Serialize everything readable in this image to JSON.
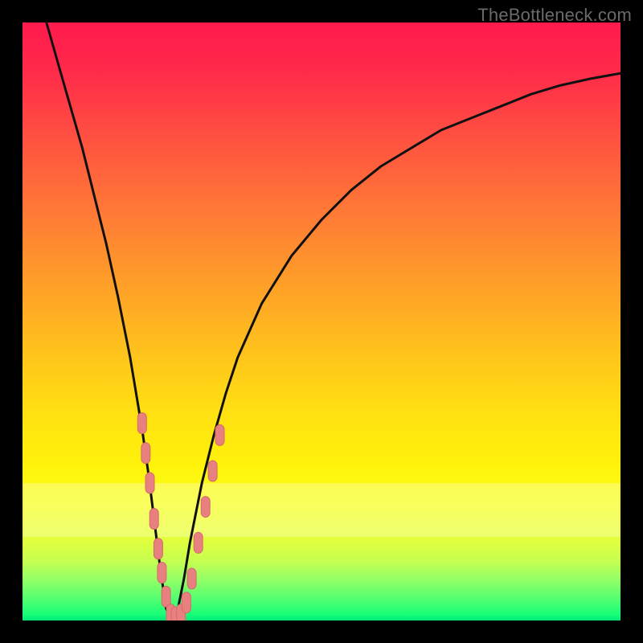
{
  "watermark": "TheBottleneck.com",
  "colors": {
    "frame": "#000000",
    "curve": "#111111",
    "marker_fill": "#e98080",
    "marker_stroke": "#d36b6b"
  },
  "chart_data": {
    "type": "line",
    "title": "",
    "xlabel": "",
    "ylabel": "",
    "xlim": [
      0,
      100
    ],
    "ylim": [
      0,
      100
    ],
    "grid": false,
    "legend": false,
    "series": [
      {
        "name": "bottleneck-curve",
        "x": [
          4,
          6,
          8,
          10,
          12,
          14,
          16,
          18,
          20,
          21,
          22,
          23,
          24,
          25,
          26,
          27,
          28,
          30,
          32,
          34,
          36,
          40,
          45,
          50,
          55,
          60,
          65,
          70,
          75,
          80,
          85,
          90,
          95,
          100
        ],
        "y": [
          100,
          93,
          86,
          79,
          71,
          63,
          54,
          44,
          32,
          25,
          17,
          9,
          2,
          0,
          2,
          7,
          13,
          23,
          31,
          38,
          44,
          53,
          61,
          67,
          72,
          76,
          79,
          82,
          84,
          86,
          88,
          89.5,
          90.6,
          91.5
        ]
      }
    ],
    "annotations": {
      "pale_band_y_range": [
        16,
        25
      ]
    },
    "markers": {
      "name": "datapoints-overlay",
      "shape": "capsule",
      "points": [
        {
          "x": 20.0,
          "y": 33
        },
        {
          "x": 20.6,
          "y": 28
        },
        {
          "x": 21.3,
          "y": 23
        },
        {
          "x": 22.0,
          "y": 17
        },
        {
          "x": 22.7,
          "y": 12
        },
        {
          "x": 23.3,
          "y": 8
        },
        {
          "x": 24.0,
          "y": 4
        },
        {
          "x": 24.8,
          "y": 1
        },
        {
          "x": 25.6,
          "y": 0.5
        },
        {
          "x": 26.5,
          "y": 1
        },
        {
          "x": 27.4,
          "y": 3
        },
        {
          "x": 28.3,
          "y": 7
        },
        {
          "x": 29.4,
          "y": 13
        },
        {
          "x": 30.6,
          "y": 19
        },
        {
          "x": 31.8,
          "y": 25
        },
        {
          "x": 33.0,
          "y": 31
        }
      ]
    }
  }
}
